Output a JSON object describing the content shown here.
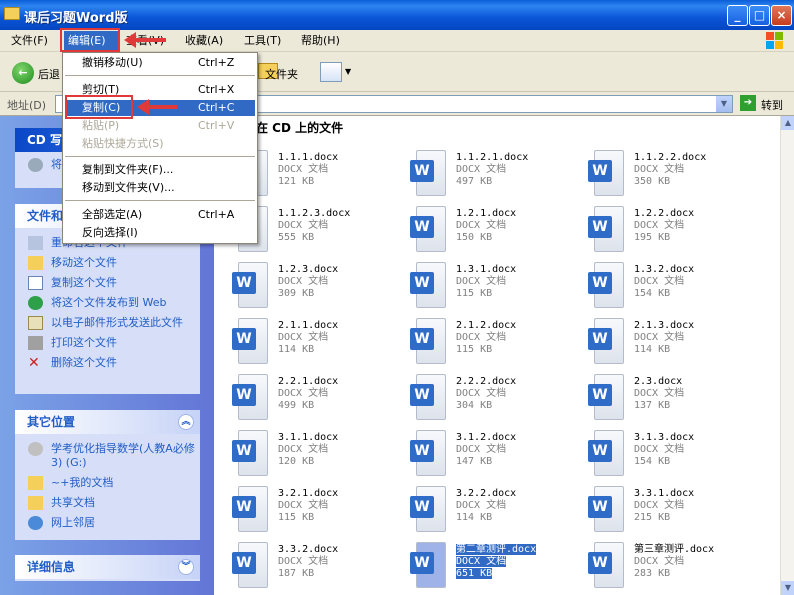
{
  "window": {
    "title": "课后习题Word版"
  },
  "menubar": {
    "items": [
      "文件(F)",
      "编辑(E)",
      "查看(V)",
      "收藏(A)",
      "工具(T)",
      "帮助(H)"
    ]
  },
  "toolbar": {
    "back": "后退",
    "folders": "文件夹"
  },
  "address": {
    "label": "地址(D)",
    "go": "转到"
  },
  "edit_menu": {
    "items": [
      {
        "label": "撤销移动(U)",
        "shortcut": "Ctrl+Z",
        "disabled": false
      },
      {
        "label": "剪切(T)",
        "shortcut": "Ctrl+X",
        "disabled": false
      },
      {
        "label": "复制(C)",
        "shortcut": "Ctrl+C",
        "disabled": false,
        "highlighted": true
      },
      {
        "label": "粘贴(P)",
        "shortcut": "Ctrl+V",
        "disabled": true
      },
      {
        "label": "粘贴快捷方式(S)",
        "shortcut": "",
        "disabled": true
      },
      {
        "label": "复制到文件夹(F)...",
        "shortcut": "",
        "disabled": false
      },
      {
        "label": "移动到文件夹(V)...",
        "shortcut": "",
        "disabled": false
      },
      {
        "label": "全部选定(A)",
        "shortcut": "Ctrl+A",
        "disabled": false
      },
      {
        "label": "反向选择(I)",
        "shortcut": "",
        "disabled": false
      }
    ]
  },
  "left_pane": {
    "cd_tasks": {
      "title": "CD 写",
      "item": "将"
    },
    "file_tasks": {
      "title": "文件和",
      "items": [
        "重命名这个文件",
        "移动这个文件",
        "复制这个文件",
        "将这个文件发布到 Web",
        "以电子邮件形式发送此文件",
        "打印这个文件",
        "删除这个文件"
      ]
    },
    "other_places": {
      "title": "其它位置",
      "items": [
        "学考优化指导数学(人教A必修3) (G:)",
        "~+我的文档",
        "共享文档",
        "网上邻居"
      ]
    },
    "details": {
      "title": "详细信息"
    }
  },
  "file_pane": {
    "header": "在 CD 上的文件",
    "files": [
      {
        "name": "1.1.1.docx",
        "type": "DOCX 文档",
        "size": "121 KB"
      },
      {
        "name": "1.1.2.1.docx",
        "type": "DOCX 文档",
        "size": "497 KB"
      },
      {
        "name": "1.1.2.2.docx",
        "type": "DOCX 文档",
        "size": "350 KB"
      },
      {
        "name": "1.1.2.3.docx",
        "type": "DOCX 文档",
        "size": "555 KB"
      },
      {
        "name": "1.2.1.docx",
        "type": "DOCX 文档",
        "size": "150 KB"
      },
      {
        "name": "1.2.2.docx",
        "type": "DOCX 文档",
        "size": "195 KB"
      },
      {
        "name": "1.2.3.docx",
        "type": "DOCX 文档",
        "size": "309 KB"
      },
      {
        "name": "1.3.1.docx",
        "type": "DOCX 文档",
        "size": "115 KB"
      },
      {
        "name": "1.3.2.docx",
        "type": "DOCX 文档",
        "size": "154 KB"
      },
      {
        "name": "2.1.1.docx",
        "type": "DOCX 文档",
        "size": "114 KB"
      },
      {
        "name": "2.1.2.docx",
        "type": "DOCX 文档",
        "size": "115 KB"
      },
      {
        "name": "2.1.3.docx",
        "type": "DOCX 文档",
        "size": "114 KB"
      },
      {
        "name": "2.2.1.docx",
        "type": "DOCX 文档",
        "size": "499 KB"
      },
      {
        "name": "2.2.2.docx",
        "type": "DOCX 文档",
        "size": "304 KB"
      },
      {
        "name": "2.3.docx",
        "type": "DOCX 文档",
        "size": "137 KB"
      },
      {
        "name": "3.1.1.docx",
        "type": "DOCX 文档",
        "size": "120 KB"
      },
      {
        "name": "3.1.2.docx",
        "type": "DOCX 文档",
        "size": "147 KB"
      },
      {
        "name": "3.1.3.docx",
        "type": "DOCX 文档",
        "size": "154 KB"
      },
      {
        "name": "3.2.1.docx",
        "type": "DOCX 文档",
        "size": "115 KB"
      },
      {
        "name": "3.2.2.docx",
        "type": "DOCX 文档",
        "size": "114 KB"
      },
      {
        "name": "3.3.1.docx",
        "type": "DOCX 文档",
        "size": "215 KB"
      },
      {
        "name": "3.3.2.docx",
        "type": "DOCX 文档",
        "size": "187 KB"
      },
      {
        "name": "第二章测评.docx",
        "type": "DOCX 文档",
        "size": "651 KB",
        "selected": true
      },
      {
        "name": "第三章测评.docx",
        "type": "DOCX 文档",
        "size": "283 KB"
      }
    ]
  },
  "colors": {
    "titlebar": "#0a55d6",
    "menu_highlight": "#316ac5",
    "annotation": "#e0393a",
    "panel_bg": "#d6dff7"
  }
}
